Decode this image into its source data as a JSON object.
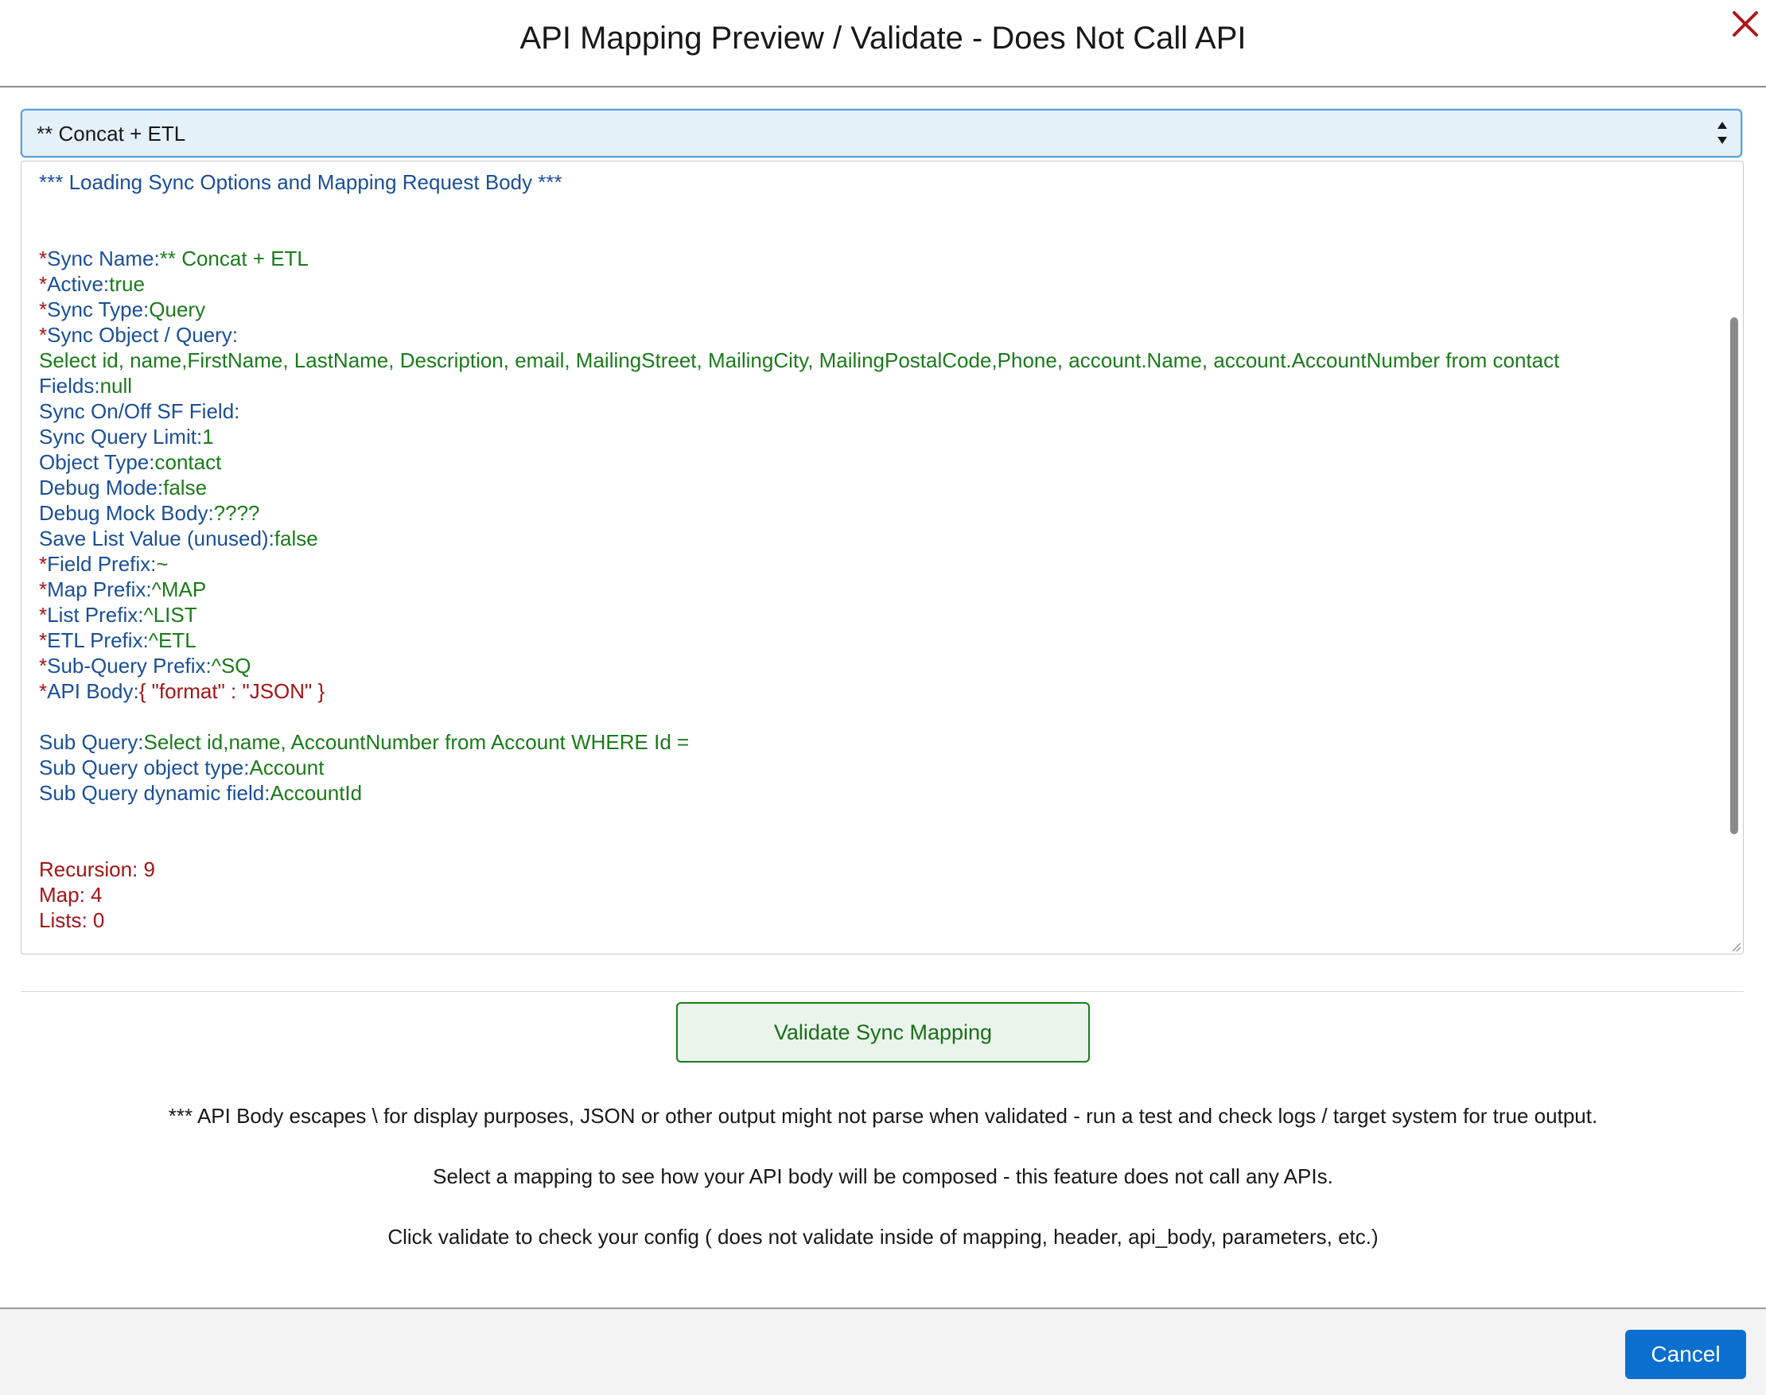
{
  "header": {
    "title": "API Mapping Preview / Validate - Does Not Call API",
    "close_icon": "close-icon"
  },
  "select": {
    "value": "** Concat + ETL"
  },
  "log": {
    "heading": "*** Loading Sync Options and Mapping Request Body ***",
    "sync_name_label": "Sync Name:",
    "sync_name_value": "** Concat + ETL",
    "active_label": "Active:",
    "active_value": "true",
    "sync_type_label": "Sync Type:",
    "sync_type_value": "Query",
    "sync_object_label": "Sync Object / Query:",
    "sync_object_query": "Select id, name,FirstName, LastName, Description, email, MailingStreet, MailingCity, MailingPostalCode,Phone, account.Name, account.AccountNumber from contact",
    "fields_label": "Fields:",
    "fields_value": "null",
    "sync_onoff_label": "Sync On/Off SF Field:",
    "sync_query_limit_label": "Sync Query Limit:",
    "sync_query_limit_value": "1",
    "object_type_label": "Object Type:",
    "object_type_value": "contact",
    "debug_mode_label": "Debug Mode:",
    "debug_mode_value": "false",
    "debug_mock_label": "Debug Mock Body:",
    "debug_mock_value": "????",
    "save_list_label": "Save List Value (unused):",
    "save_list_value": "false",
    "field_prefix_label": "Field Prefix:",
    "field_prefix_value": "~",
    "map_prefix_label": "Map Prefix:",
    "map_prefix_value": "^MAP",
    "list_prefix_label": "List Prefix:",
    "list_prefix_value": "^LIST",
    "etl_prefix_label": "ETL Prefix:",
    "etl_prefix_value": "^ETL",
    "subquery_prefix_label": "Sub-Query Prefix:",
    "subquery_prefix_value": "^SQ",
    "api_body_label": "API Body:",
    "api_body_value": "{ \"format\" : \"JSON\" }",
    "sub_query_label": "Sub Query:",
    "sub_query_value": "Select id,name, AccountNumber from Account WHERE Id =",
    "sub_query_type_label": "Sub Query object type:",
    "sub_query_type_value": "Account",
    "sub_query_dyn_label": "Sub Query dynamic field:",
    "sub_query_dyn_value": "AccountId",
    "recursion": "Recursion: 9",
    "map": "Map: 4",
    "lists": "Lists: 0",
    "required_marker": "*"
  },
  "actions": {
    "validate_label": "Validate Sync Mapping",
    "cancel_label": "Cancel"
  },
  "notes": {
    "note1": "*** API Body escapes \\ for display purposes, JSON or other output might not parse when validated - run a test and check logs / target system for true output.",
    "note2": "Select a mapping to see how your API body will be composed - this feature does not call any APIs.",
    "note3": "Click validate to check your config ( does not validate inside of mapping, header, api_body, parameters, etc.)"
  },
  "colors": {
    "label_blue": "#1a4f96",
    "value_green": "#1b7a1b",
    "required_red": "#a31515",
    "cancel_blue": "#0b6fcf",
    "select_bg": "#e5f1f8"
  }
}
